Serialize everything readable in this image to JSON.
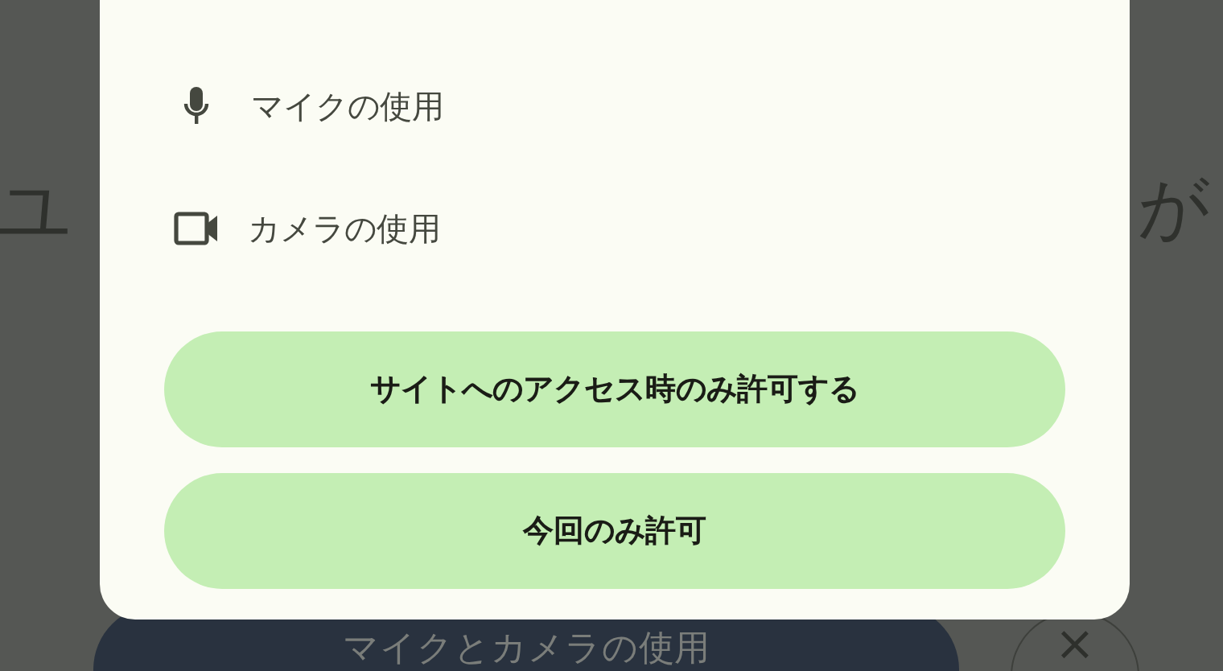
{
  "background_page": {
    "heading_left": "ユ",
    "heading_right": "が",
    "primary_button": "マイクとカメラの使用",
    "close_button": "×"
  },
  "dialog": {
    "permissions": [
      {
        "kind": "microphone",
        "label": "マイクの使用"
      },
      {
        "kind": "camera",
        "label": "カメラの使用"
      }
    ],
    "buttons": [
      "サイトへのアクセス時のみ許可する",
      "今回のみ許可"
    ]
  }
}
